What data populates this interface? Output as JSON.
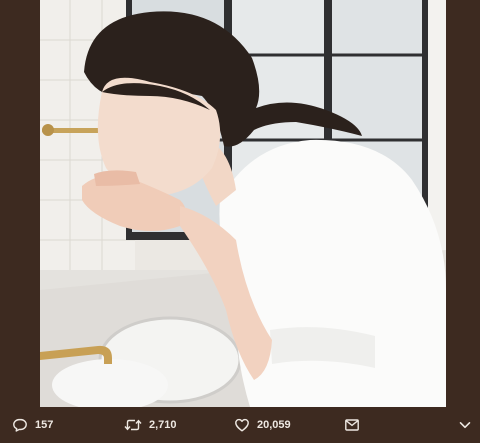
{
  "actions": {
    "reply_count": "157",
    "retweet_count": "2,710",
    "like_count": "20,059"
  },
  "icons": {
    "reply": "speech-bubble-icon",
    "retweet": "retweet-arrows-icon",
    "like": "heart-icon",
    "message": "envelope-icon",
    "more": "chevron-down-icon"
  },
  "colors": {
    "background": "#3d2a20",
    "icon": "#eee8e2"
  }
}
